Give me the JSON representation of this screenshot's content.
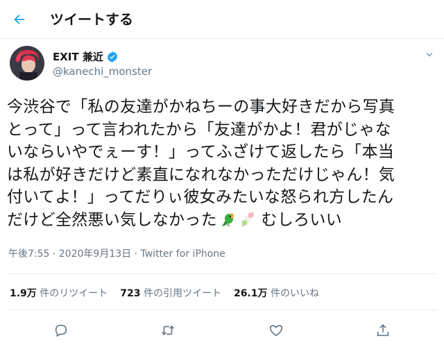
{
  "header": {
    "title": "ツイートする"
  },
  "author": {
    "name": "EXIT 兼近",
    "handle": "@kanechi_monster"
  },
  "tweet": {
    "text": "今渋谷で「私の友達がかねちーの事大好きだから写真\nとって」って言われたから「友達がかよ！君がじゃな\nいならいやでぇーす！」ってふざけて返したら「本当\nは私が好きだけど素直になれなかっただけじゃん！気\n付いてよ！」ってだりぃ彼女みたいな怒られ方したん\nだけど全然悪い気しなかった",
    "text_tail": " むしろいい",
    "emoji_1": "parrot-emoji",
    "emoji_2": "dango-emoji",
    "timestamp": "午後7:55 · 2020年9月13日 · Twitter for iPhone"
  },
  "stats": {
    "retweets_count": "1.9万",
    "retweets_label": "件のリツイート",
    "quotes_count": "723",
    "quotes_label": "件の引用ツイート",
    "likes_count": "26.1万",
    "likes_label": "件のいいね"
  },
  "colors": {
    "accent": "#1da1f2",
    "text": "#14171a",
    "secondary": "#657786",
    "border": "#e6ecf0"
  }
}
